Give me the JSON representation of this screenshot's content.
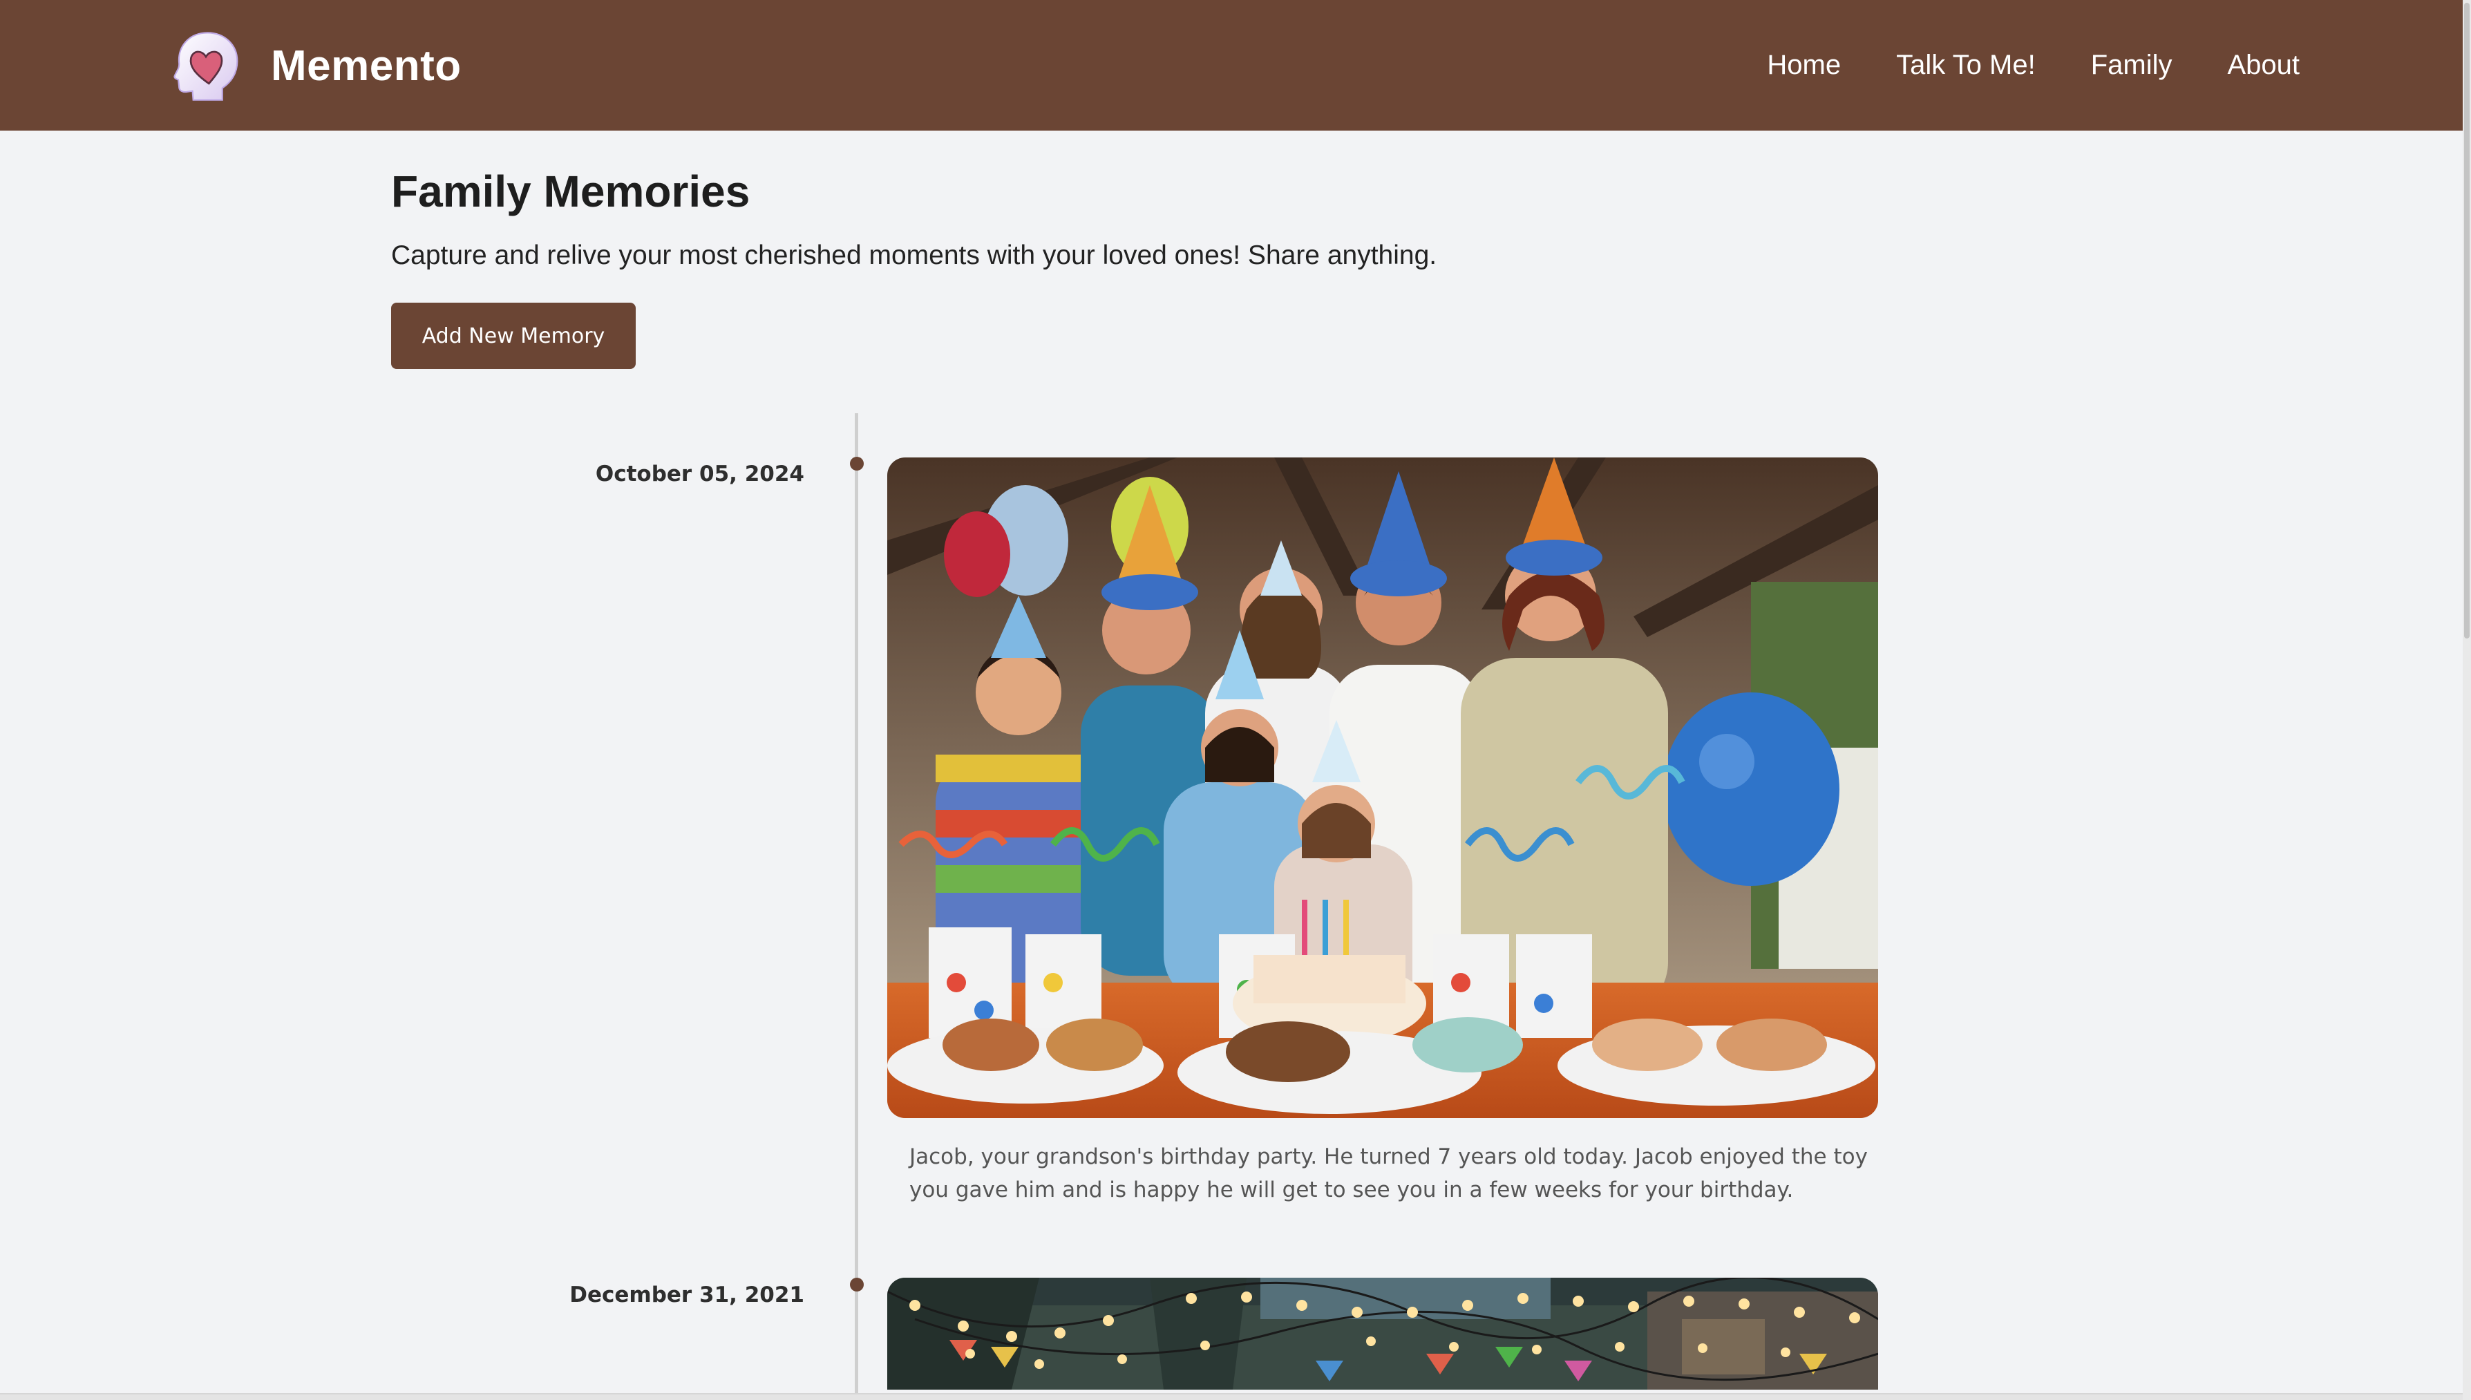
{
  "app": {
    "name": "Memento",
    "logo_icon": "head-heart-icon",
    "brand_color": "#6b4534"
  },
  "nav": {
    "items": [
      {
        "label": "Home"
      },
      {
        "label": "Talk To Me!"
      },
      {
        "label": "Family"
      },
      {
        "label": "About"
      }
    ]
  },
  "header": {
    "title": "Family Memories",
    "subtitle": "Capture and relive your most cherished moments with your loved ones! Share anything.",
    "add_button_label": "Add New Memory"
  },
  "memories": [
    {
      "date": "October 05, 2024",
      "image_description": "family-birthday-party-photo",
      "caption": "Jacob, your grandson's birthday party. He turned 7 years old today. Jacob enjoyed the toy you gave him and is happy he will get to see you in a few weeks for your birthday."
    },
    {
      "date": "December 31, 2021",
      "image_description": "string-lights-party-photo",
      "caption": ""
    }
  ]
}
